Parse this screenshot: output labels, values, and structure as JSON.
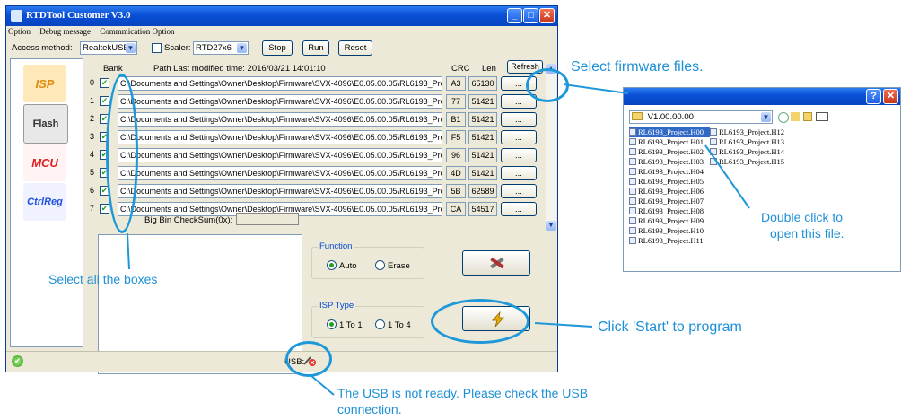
{
  "window": {
    "title": "RTDTool Customer V3.0",
    "menu": [
      "Option",
      "Debug message",
      "Commmication Option"
    ]
  },
  "toolbar": {
    "access_label": "Access method:",
    "access_value": "RealtekUSB",
    "scaler_label": "Scaler:",
    "scaler_value": "RTD27x6",
    "stop": "Stop",
    "run": "Run",
    "reset": "Reset"
  },
  "side_tiles": [
    {
      "label": "ISP",
      "color": "#f0a020"
    },
    {
      "label": "Flash",
      "color": "#555555"
    },
    {
      "label": "MCU",
      "color": "#e02020"
    },
    {
      "label": "CtrlReg",
      "color": "#2050e0"
    }
  ],
  "table": {
    "bank_header": "Bank",
    "path_header": "Path   Last modified time: 2016/03/21 14:01:10",
    "crc_header": "CRC",
    "len_header": "Len",
    "refresh": "Refresh",
    "rows": [
      {
        "bank": "0",
        "path": "C:\\Documents and Settings\\Owner\\Desktop\\Firmware\\SVX-4096\\E0.05.00.05\\RL6193_Proje",
        "crc": "A3",
        "len": "65130",
        "btn": "..."
      },
      {
        "bank": "1",
        "path": "C:\\Documents and Settings\\Owner\\Desktop\\Firmware\\SVX-4096\\E0.05.00.05\\RL6193_Project.H",
        "crc": "77",
        "len": "51421",
        "btn": "..."
      },
      {
        "bank": "2",
        "path": "C:\\Documents and Settings\\Owner\\Desktop\\Firmware\\SVX-4096\\E0.05.00.05\\RL6193_Project.H",
        "crc": "B1",
        "len": "51421",
        "btn": "..."
      },
      {
        "bank": "3",
        "path": "C:\\Documents and Settings\\Owner\\Desktop\\Firmware\\SVX-4096\\E0.05.00.05\\RL6193_Project.H",
        "crc": "F5",
        "len": "51421",
        "btn": "..."
      },
      {
        "bank": "4",
        "path": "C:\\Documents and Settings\\Owner\\Desktop\\Firmware\\SVX-4096\\E0.05.00.05\\RL6193_Project.H",
        "crc": "96",
        "len": "51421",
        "btn": "..."
      },
      {
        "bank": "5",
        "path": "C:\\Documents and Settings\\Owner\\Desktop\\Firmware\\SVX-4096\\E0.05.00.05\\RL6193_Project.H",
        "crc": "4D",
        "len": "51421",
        "btn": "..."
      },
      {
        "bank": "6",
        "path": "C:\\Documents and Settings\\Owner\\Desktop\\Firmware\\SVX-4096\\E0.05.00.05\\RL6193_Project.H",
        "crc": "5B",
        "len": "62589",
        "btn": "..."
      },
      {
        "bank": "7",
        "path": "C:\\Documents and Settings\\Owner\\Desktop\\Firmware\\SVX-4096\\E0.05.00.05\\RL6193_Project.H",
        "crc": "CA",
        "len": "54517",
        "btn": "..."
      }
    ],
    "checksum_label": "Big Bin CheckSum(0x):"
  },
  "function_group": {
    "title": "Function",
    "options": [
      "Auto",
      "Erase"
    ],
    "selected": "Auto"
  },
  "isp_group": {
    "title": "ISP Type",
    "options": [
      "1 To 1",
      "1 To 4"
    ],
    "selected": "1 To 1"
  },
  "status": {
    "usb_label": "USB:"
  },
  "dialog": {
    "folder": "V1.00.00.00",
    "files_col1": [
      "RL6193_Project.H00",
      "RL6193_Project.H01",
      "RL6193_Project.H02",
      "RL6193_Project.H03",
      "RL6193_Project.H04",
      "RL6193_Project.H05",
      "RL6193_Project.H06",
      "RL6193_Project.H07",
      "RL6193_Project.H08",
      "RL6193_Project.H09",
      "RL6193_Project.H10",
      "RL6193_Project.H11"
    ],
    "files_col2": [
      "RL6193_Project.H12",
      "RL6193_Project.H13",
      "RL6193_Project.H14",
      "RL6193_Project.H15"
    ]
  },
  "callouts": {
    "select_firmware": "Select firmware files.",
    "double_click_1": "Double click to",
    "double_click_2": "open this file.",
    "select_boxes": "Select all the boxes",
    "click_start": "Click 'Start' to program",
    "usb_note_1": "The USB is not ready. Please check the USB",
    "usb_note_2": "connection."
  },
  "colors": {
    "callout": "#1e90d6",
    "title_bar": "#0a4fd6",
    "check": "#21a121"
  }
}
